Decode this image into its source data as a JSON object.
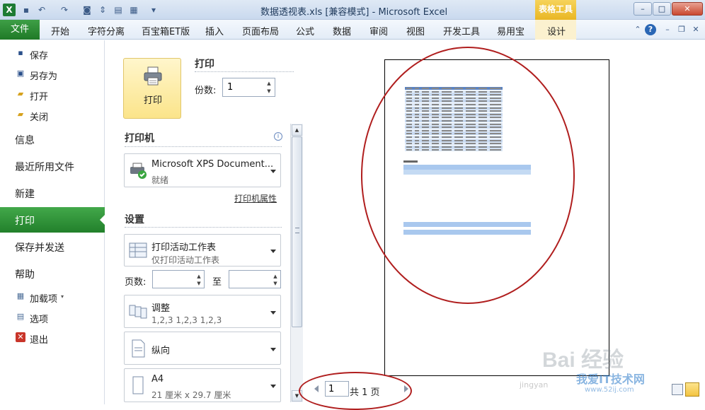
{
  "window": {
    "title": "数据透视表.xls  [兼容模式] - Microsoft Excel",
    "context_tab_group": "表格工具"
  },
  "ribbon": {
    "file_tab": "文件",
    "tabs": [
      "开始",
      "字符分离",
      "百宝箱ET版",
      "插入",
      "页面布局",
      "公式",
      "数据",
      "审阅",
      "视图",
      "开发工具",
      "易用宝",
      "设计"
    ]
  },
  "nav": {
    "save": "保存",
    "save_as": "另存为",
    "open": "打开",
    "close": "关闭",
    "info": "信息",
    "recent": "最近所用文件",
    "new": "新建",
    "print": "打印",
    "save_send": "保存并发送",
    "help": "帮助",
    "addins": "加载项",
    "options": "选项",
    "exit": "退出"
  },
  "print_panel": {
    "print_button": "打印",
    "print_heading": "打印",
    "copies_label": "份数:",
    "copies_value": "1",
    "printer_heading": "打印机",
    "printer_name": "Microsoft XPS Document...",
    "printer_status": "就绪",
    "printer_properties": "打印机属性",
    "settings_heading": "设置",
    "scope_main": "打印活动工作表",
    "scope_sub": "仅打印活动工作表",
    "pages_label": "页数:",
    "to_label": "至",
    "collate_main": "调整",
    "collate_sub": "1,2,3    1,2,3    1,2,3",
    "orientation": "纵向",
    "paper_main": "A4",
    "paper_sub": "21 厘米 x 29.7 厘米"
  },
  "preview": {
    "page_current": "1",
    "page_total": "共 1 页",
    "watermark_brand": "Bai 经验",
    "watermark_site": "我爱IT技术网",
    "watermark_url": "www.52ij.com",
    "watermark_jm": "jingyan"
  },
  "colors": {
    "file_tab": "#2b8a33",
    "nav_selected": "#2f9137",
    "annotation": "#b01e1e",
    "context_tab": "#efc33a",
    "preview_highlight": "#a9c8ee"
  }
}
